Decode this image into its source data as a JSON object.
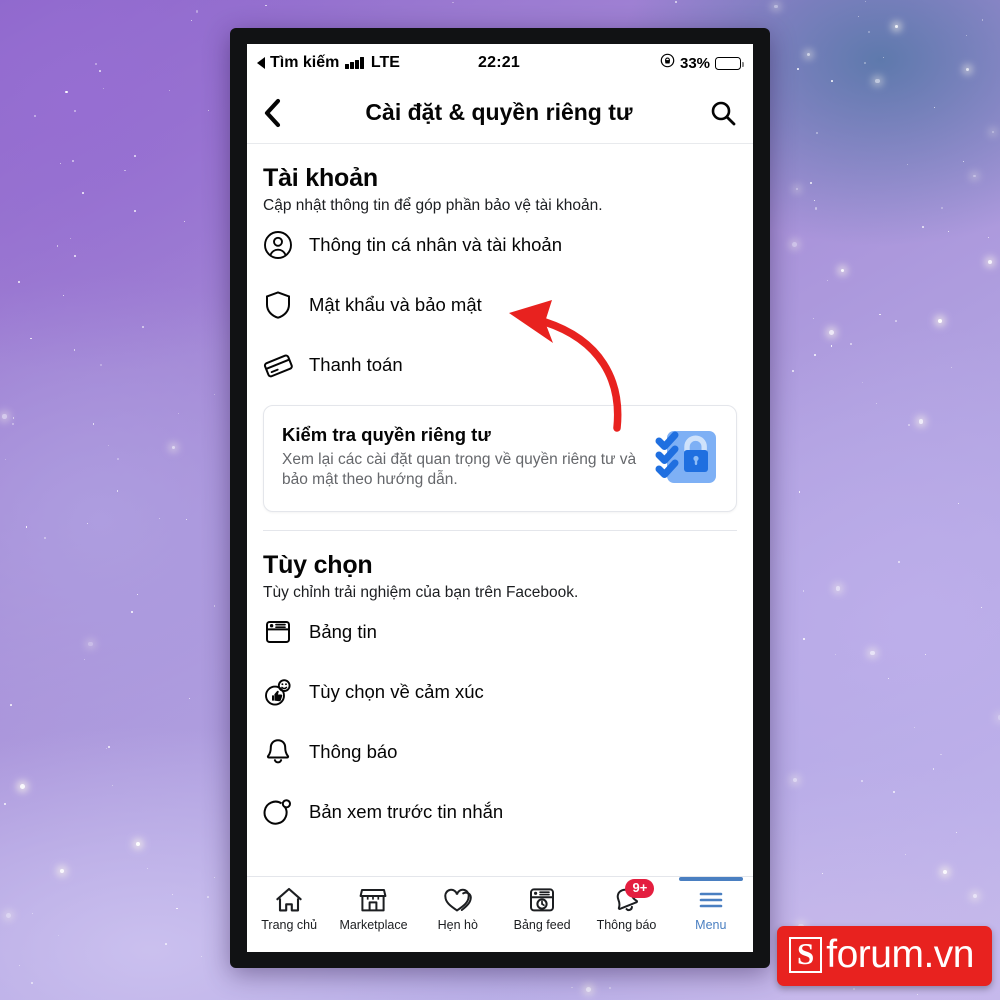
{
  "background": {
    "name": "galaxy-nebula-wallpaper",
    "colors": [
      "#8a63c9",
      "#a78fd8",
      "#b6abe6",
      "#5a78aa"
    ]
  },
  "status_bar": {
    "back_label": "Tìm kiếm",
    "network": "LTE",
    "signal_icon": "cellular-signal-icon",
    "time": "22:21",
    "battery_percent": "33%",
    "battery_level": 33,
    "orientation_lock_icon": "rotation-lock-icon"
  },
  "header": {
    "back_icon": "chevron-left-icon",
    "title": "Cài đặt & quyền riêng tư",
    "search_icon": "search-icon"
  },
  "sections": [
    {
      "title": "Tài khoản",
      "subtitle": "Cập nhật thông tin để góp phần bảo vệ tài khoản.",
      "items": [
        {
          "icon": "person-circle-icon",
          "label": "Thông tin cá nhân và tài khoản"
        },
        {
          "icon": "shield-icon",
          "label": "Mật khẩu và bảo mật"
        },
        {
          "icon": "credit-card-icon",
          "label": "Thanh toán"
        }
      ]
    },
    {
      "title": "Tùy chọn",
      "subtitle": "Tùy chỉnh trải nghiệm của bạn trên Facebook.",
      "items": [
        {
          "icon": "news-feed-icon",
          "label": "Bảng tin"
        },
        {
          "icon": "reactions-icon",
          "label": "Tùy chọn về cảm xúc"
        },
        {
          "icon": "bell-icon",
          "label": "Thông báo"
        },
        {
          "icon": "message-preview-icon",
          "label": "Bản xem trước tin nhắn"
        }
      ]
    }
  ],
  "privacy_card": {
    "title": "Kiểm tra quyền riêng tư",
    "description": "Xem lại các cài đặt quan trọng về quyền riêng tư và bảo mật theo hướng dẫn.",
    "art_icon": "privacy-checkup-lock-icon",
    "art_colors": {
      "panel": "#7eb0f5",
      "lock": "#1f6fe0",
      "check": "#1f6fe0"
    }
  },
  "tab_bar": {
    "active_color": "#4a7fc1",
    "items": [
      {
        "icon": "home-icon",
        "label": "Trang chủ",
        "active": false,
        "badge": ""
      },
      {
        "icon": "marketplace-icon",
        "label": "Marketplace",
        "active": false,
        "badge": ""
      },
      {
        "icon": "dating-hearts-icon",
        "label": "Hẹn hò",
        "active": false,
        "badge": ""
      },
      {
        "icon": "feed-board-icon",
        "label": "Bảng feed",
        "active": false,
        "badge": ""
      },
      {
        "icon": "bell-icon",
        "label": "Thông báo",
        "active": false,
        "badge": "9+"
      },
      {
        "icon": "hamburger-menu-icon",
        "label": "Menu",
        "active": true,
        "badge": ""
      }
    ]
  },
  "annotation": {
    "type": "curved-arrow",
    "color": "#e8221f",
    "points_to": "Mật khẩu và bảo mật"
  },
  "watermark": {
    "logo_letter": "S",
    "text": "forum.vn",
    "color": "#e8221f"
  }
}
